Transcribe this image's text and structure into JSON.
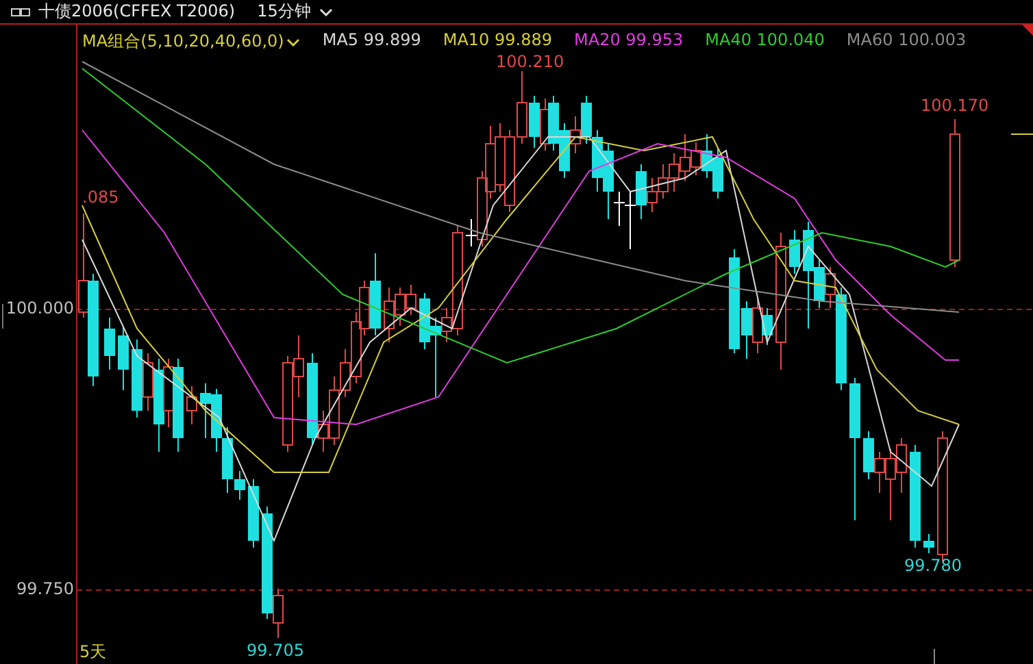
{
  "header": {
    "title": "十债2006(CFFEX T2006)",
    "period": "15分钟"
  },
  "legend": {
    "group_label": "MA组合(5,10,20,40,60,0)",
    "items": [
      {
        "label": "MA5 99.899",
        "color": "#d8d8d8"
      },
      {
        "label": "MA10 99.889",
        "color": "#d6cf3a"
      },
      {
        "label": "MA20 99.953",
        "color": "#e03ce0"
      },
      {
        "label": "MA40 100.040",
        "color": "#2ecc2e"
      },
      {
        "label": "MA60 100.003",
        "color": "#8c8c8c"
      }
    ]
  },
  "y_axis": {
    "labels": [
      "100.000",
      "99.750"
    ]
  },
  "annotations": [
    {
      "text": "100.210",
      "kind": "high"
    },
    {
      "text": ".085",
      "kind": "high"
    },
    {
      "text": "100.170",
      "kind": "high"
    },
    {
      "text": "99.705",
      "kind": "low"
    },
    {
      "text": "99.780",
      "kind": "low"
    }
  ],
  "period_label": "5天"
}
